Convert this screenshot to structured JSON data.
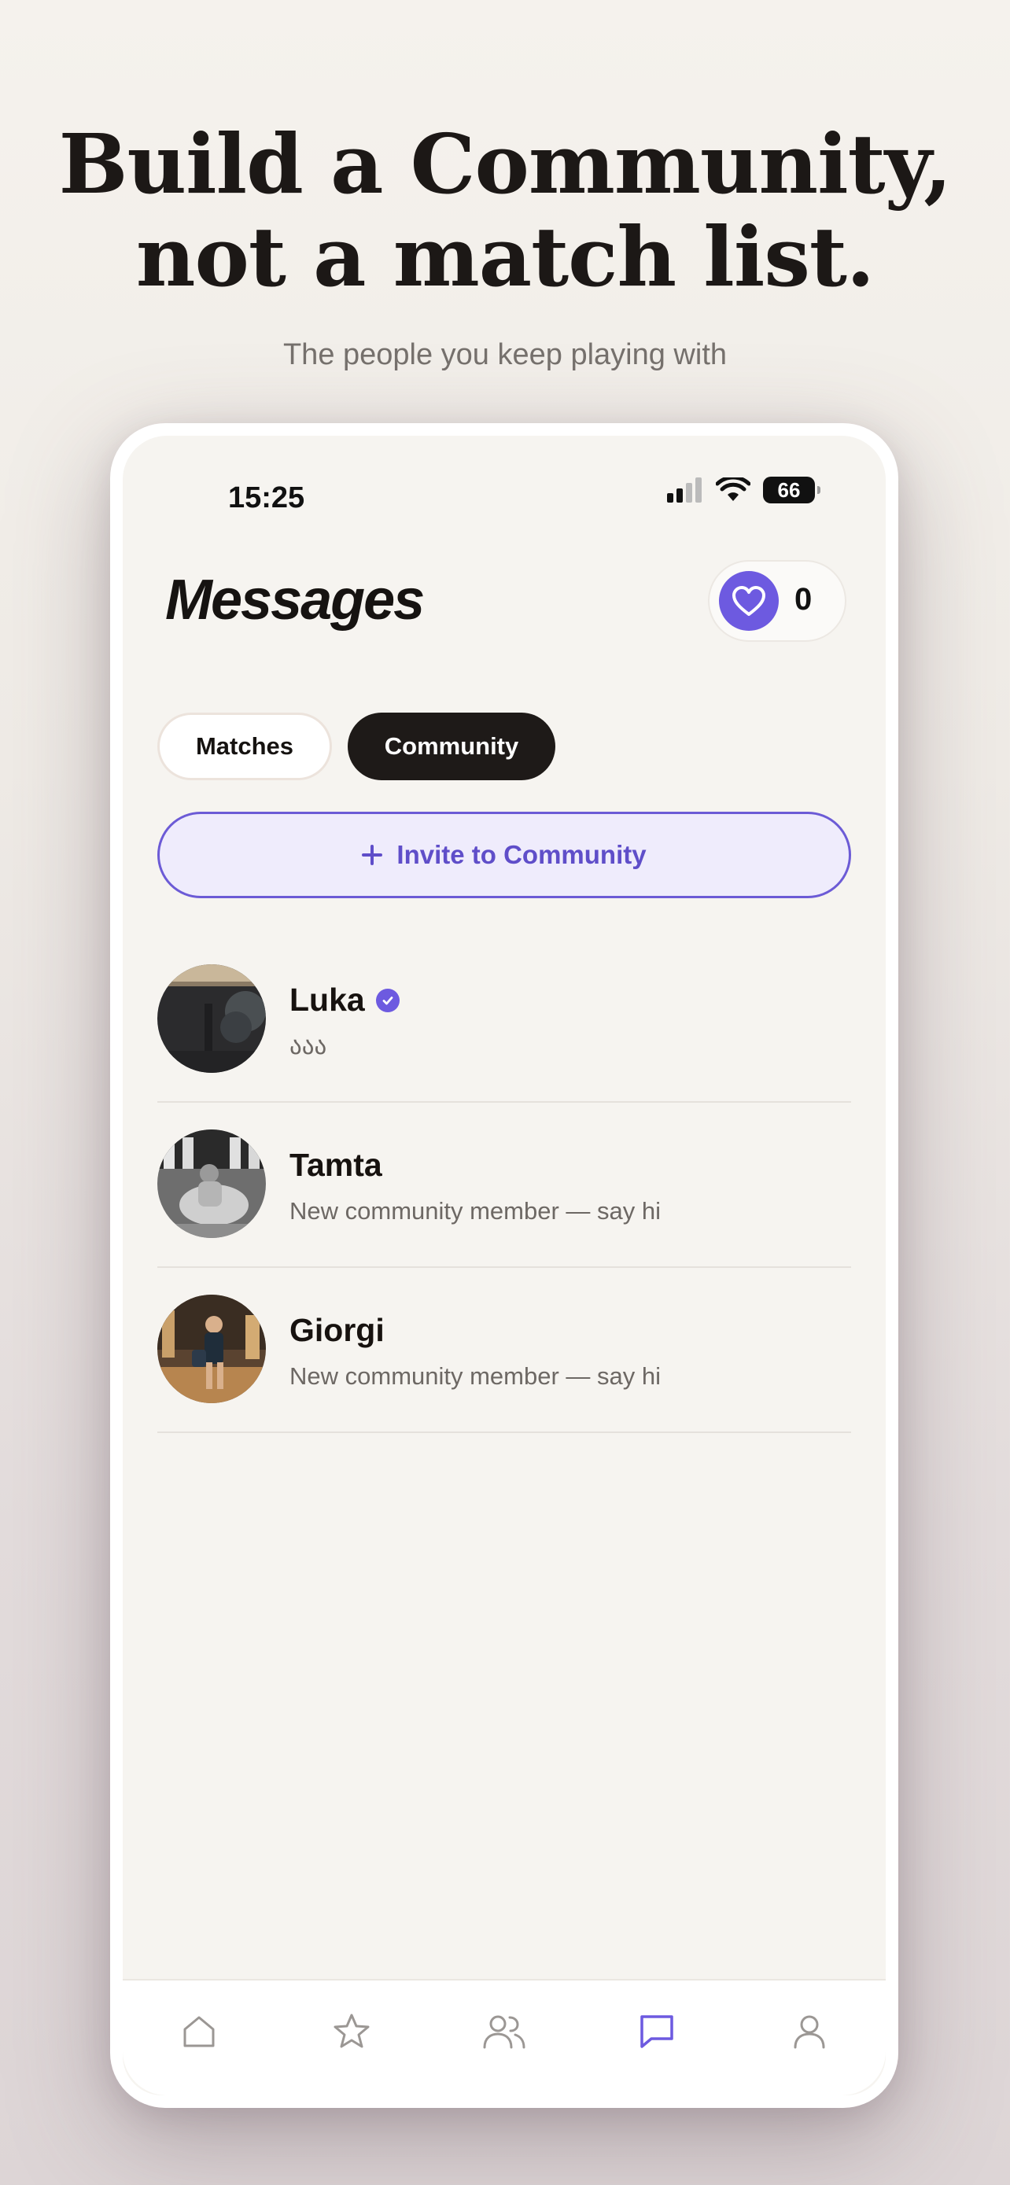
{
  "hero": {
    "headline_line1": "Build a Community,",
    "headline_line2": "not a match list.",
    "subline": "The people you keep playing with"
  },
  "status_bar": {
    "time": "15:25",
    "battery": "66"
  },
  "header": {
    "title": "Messages",
    "likes_count": "0"
  },
  "tabs": [
    {
      "label": "Matches",
      "active": false
    },
    {
      "label": "Community",
      "active": true
    }
  ],
  "invite": {
    "icon": "plus-icon",
    "label": "Invite to Community"
  },
  "conversations": [
    {
      "name": "Luka",
      "verified": true,
      "preview": "ააა"
    },
    {
      "name": "Tamta",
      "verified": false,
      "preview": "New community member — say hi"
    },
    {
      "name": "Giorgi",
      "verified": false,
      "preview": "New community member — say hi"
    }
  ],
  "bottom_nav": [
    {
      "icon": "home-icon",
      "active": false
    },
    {
      "icon": "star-icon",
      "active": false
    },
    {
      "icon": "people-icon",
      "active": false
    },
    {
      "icon": "chat-icon",
      "active": true
    },
    {
      "icon": "profile-icon",
      "active": false
    }
  ],
  "colors": {
    "accent": "#6d5ae0",
    "dark": "#1e1a18",
    "background": "#f6f4f0"
  }
}
